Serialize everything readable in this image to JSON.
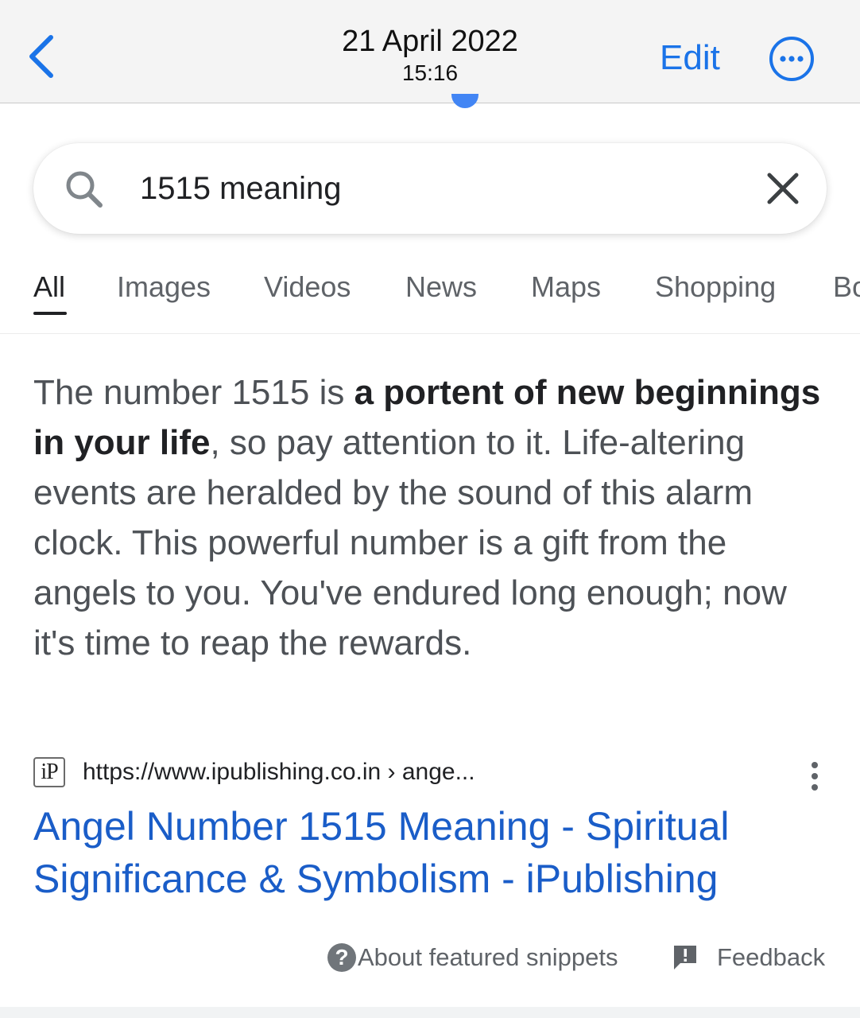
{
  "header": {
    "date": "21 April 2022",
    "time": "15:16",
    "edit_label": "Edit",
    "back_icon": "chevron-left-icon",
    "more_icon": "ellipsis-circle-icon"
  },
  "search": {
    "query": "1515 meaning",
    "search_icon": "search-icon",
    "clear_icon": "close-icon"
  },
  "tabs": [
    {
      "label": "All",
      "active": true
    },
    {
      "label": "Images",
      "active": false
    },
    {
      "label": "Videos",
      "active": false
    },
    {
      "label": "News",
      "active": false
    },
    {
      "label": "Maps",
      "active": false
    },
    {
      "label": "Shopping",
      "active": false
    },
    {
      "label": "Bo",
      "active": false
    }
  ],
  "snippet": {
    "text_before": "The number 1515 is ",
    "bold": "a portent of new beginnings in your life",
    "text_after": ", so pay attention to it. Life-altering events are heralded by the sound of this alarm clock. This powerful number is a gift from the angels to you. You've endured long enough; now it's time to reap the rewards."
  },
  "source": {
    "favicon_text": "iP",
    "url": "https://www.ipublishing.co.in › ange..."
  },
  "result": {
    "title": "Angel Number 1515 Meaning - Spiritual Significance & Symbolism - iPublishing"
  },
  "footer": {
    "about_label": "About featured snippets",
    "feedback_label": "Feedback"
  },
  "colors": {
    "accent": "#1a73e8",
    "link": "#1a5dc8",
    "text": "#4d5156"
  }
}
